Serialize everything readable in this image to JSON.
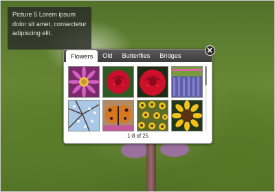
{
  "caption": {
    "text": "Picture 5 Lorem ipsum dolor sit amet, consectetur adipiscing elit."
  },
  "gallery": {
    "tabs": [
      {
        "label": "Flowers",
        "active": true
      },
      {
        "label": "Old",
        "active": false
      },
      {
        "label": "Butterflies",
        "active": false
      },
      {
        "label": "Bridges",
        "active": false
      }
    ],
    "thumbnails": [
      {
        "subject": "purple-daisy"
      },
      {
        "subject": "red-rose"
      },
      {
        "subject": "red-rose"
      },
      {
        "subject": "lavender-field"
      },
      {
        "subject": "blossom-branches"
      },
      {
        "subject": "butterfly"
      },
      {
        "subject": "sunflower-field"
      },
      {
        "subject": "sunflower"
      }
    ],
    "pager_text": "1-8 of 25"
  },
  "close_icon": "close-icon",
  "colors": {
    "tab_bar": "#4a4a4a",
    "caption_bg": "#282828",
    "background_grass": "#5e7f2e"
  }
}
